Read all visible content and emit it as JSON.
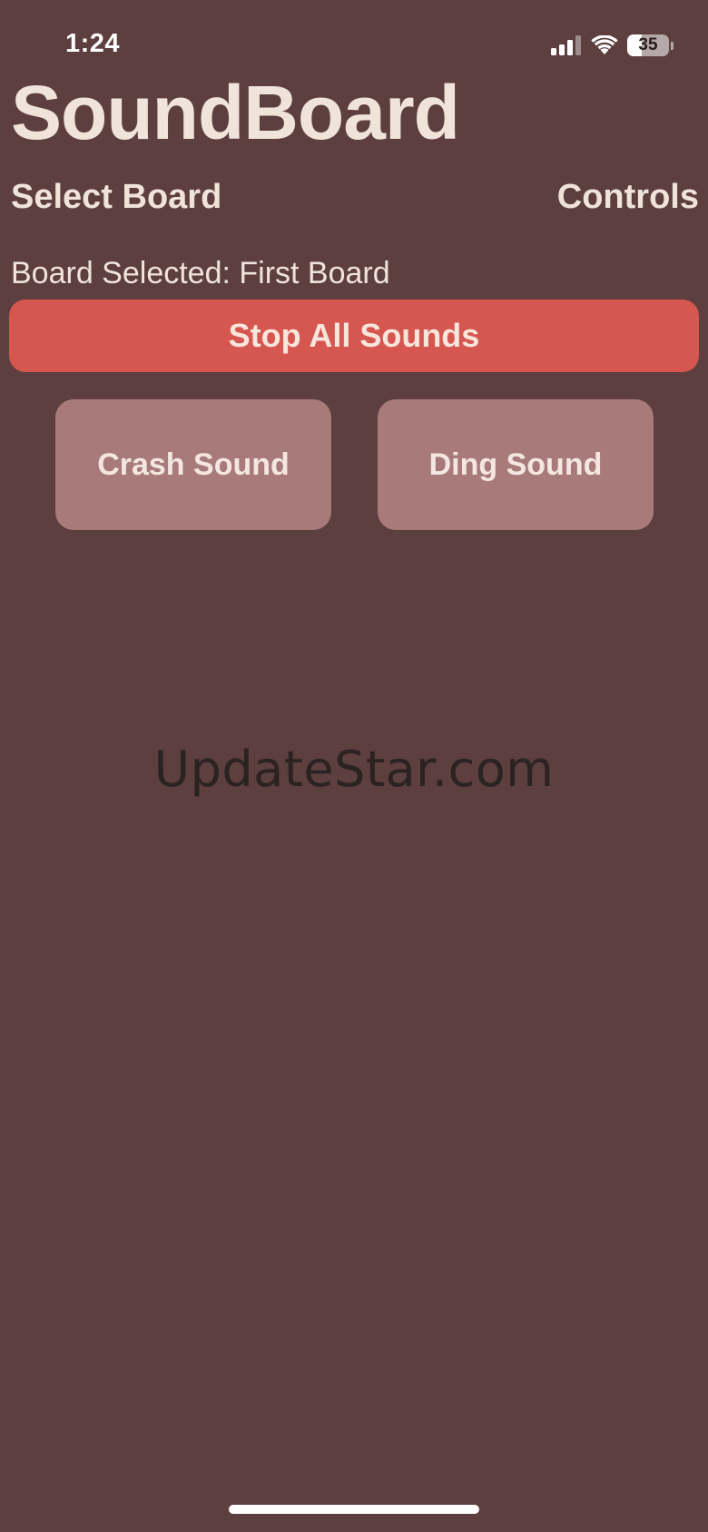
{
  "status_bar": {
    "time": "1:24",
    "battery": 35,
    "signal_icon": "cellular-signal-icon",
    "wifi_icon": "wifi-icon"
  },
  "app": {
    "title": "SoundBoard"
  },
  "nav": {
    "select_board": "Select Board",
    "controls": "Controls"
  },
  "board": {
    "selected_text": "Board Selected: First Board"
  },
  "actions": {
    "stop_all": "Stop All Sounds"
  },
  "sounds": [
    {
      "label": "Crash Sound"
    },
    {
      "label": "Ding Sound"
    }
  ],
  "watermark": "UpdateStar.com",
  "colors": {
    "background": "#5c3f3e",
    "stop_button": "#d65650",
    "sound_button": "#a87b7a",
    "text": "#f0e3da"
  }
}
